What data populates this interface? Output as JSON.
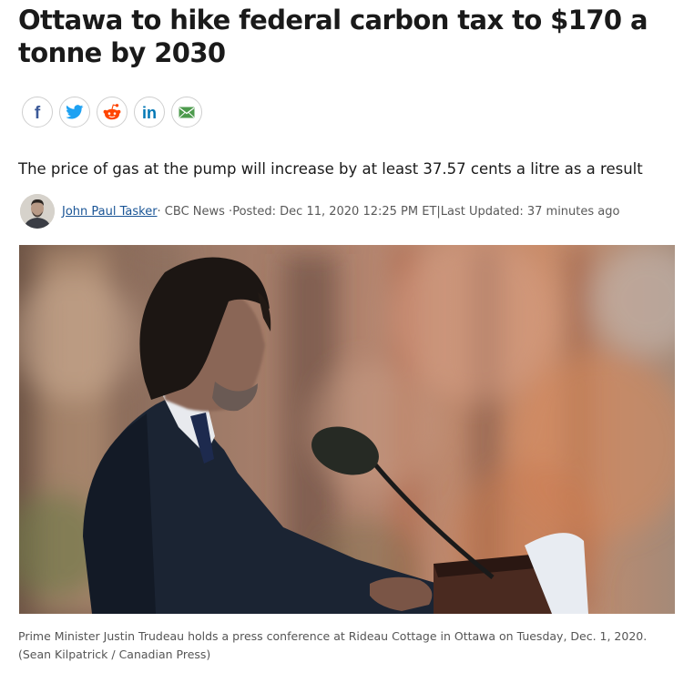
{
  "article": {
    "headline": "Ottawa to hike federal carbon tax to $170 a tonne by 2030",
    "deck": "The price of gas at the pump will increase by at least 37.57 cents a litre as a result",
    "byline": {
      "author": "John Paul Tasker",
      "source": " · CBC News · ",
      "posted": "Posted: Dec 11, 2020 12:25 PM ET",
      "separator": " | ",
      "updated": "Last Updated: 37 minutes ago"
    },
    "photo": {
      "caption": "Prime Minister Justin Trudeau holds a press conference at Rideau Cottage in Ottawa on Tuesday, Dec. 1, 2020.",
      "credit": "(Sean Kilpatrick / Canadian Press)"
    }
  },
  "share_buttons": [
    {
      "icon": "facebook-icon",
      "color": "#3b5998"
    },
    {
      "icon": "twitter-icon",
      "color": "#1da1f2"
    },
    {
      "icon": "reddit-icon",
      "color": "#ff4500"
    },
    {
      "icon": "linkedin-icon",
      "color": "#0077b5"
    },
    {
      "icon": "email-icon",
      "color": "#4d9b4d"
    }
  ],
  "colors": {
    "author_link": "#1a5596",
    "text": "#1a1a1a",
    "meta": "#595959"
  }
}
